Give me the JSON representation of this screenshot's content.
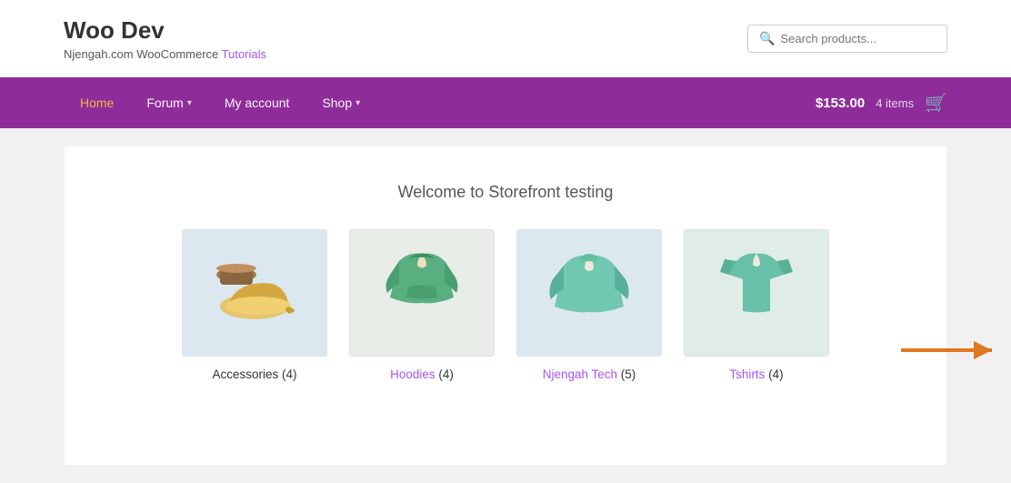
{
  "header": {
    "site_title": "Woo Dev",
    "site_tagline_plain": "Njengah.com WooCommerce ",
    "site_tagline_link": "Tutorials",
    "search_placeholder": "Search products..."
  },
  "navbar": {
    "items": [
      {
        "label": "Home",
        "has_dropdown": false,
        "is_active": true
      },
      {
        "label": "Forum",
        "has_dropdown": true,
        "is_active": false
      },
      {
        "label": "My account",
        "has_dropdown": false,
        "is_active": false
      },
      {
        "label": "Shop",
        "has_dropdown": true,
        "is_active": false
      }
    ],
    "cart_price": "$153.00",
    "cart_items": "4 items"
  },
  "main": {
    "welcome_text": "Welcome to Storefront testing",
    "products": [
      {
        "name": "Accessories",
        "count": "(4)",
        "is_link": false
      },
      {
        "name": "Hoodies",
        "count": "(4)",
        "is_link": true
      },
      {
        "name": "Njengah Tech",
        "count": "(5)",
        "is_link": true
      },
      {
        "name": "Tshirts",
        "count": "(4)",
        "is_link": true
      }
    ]
  }
}
